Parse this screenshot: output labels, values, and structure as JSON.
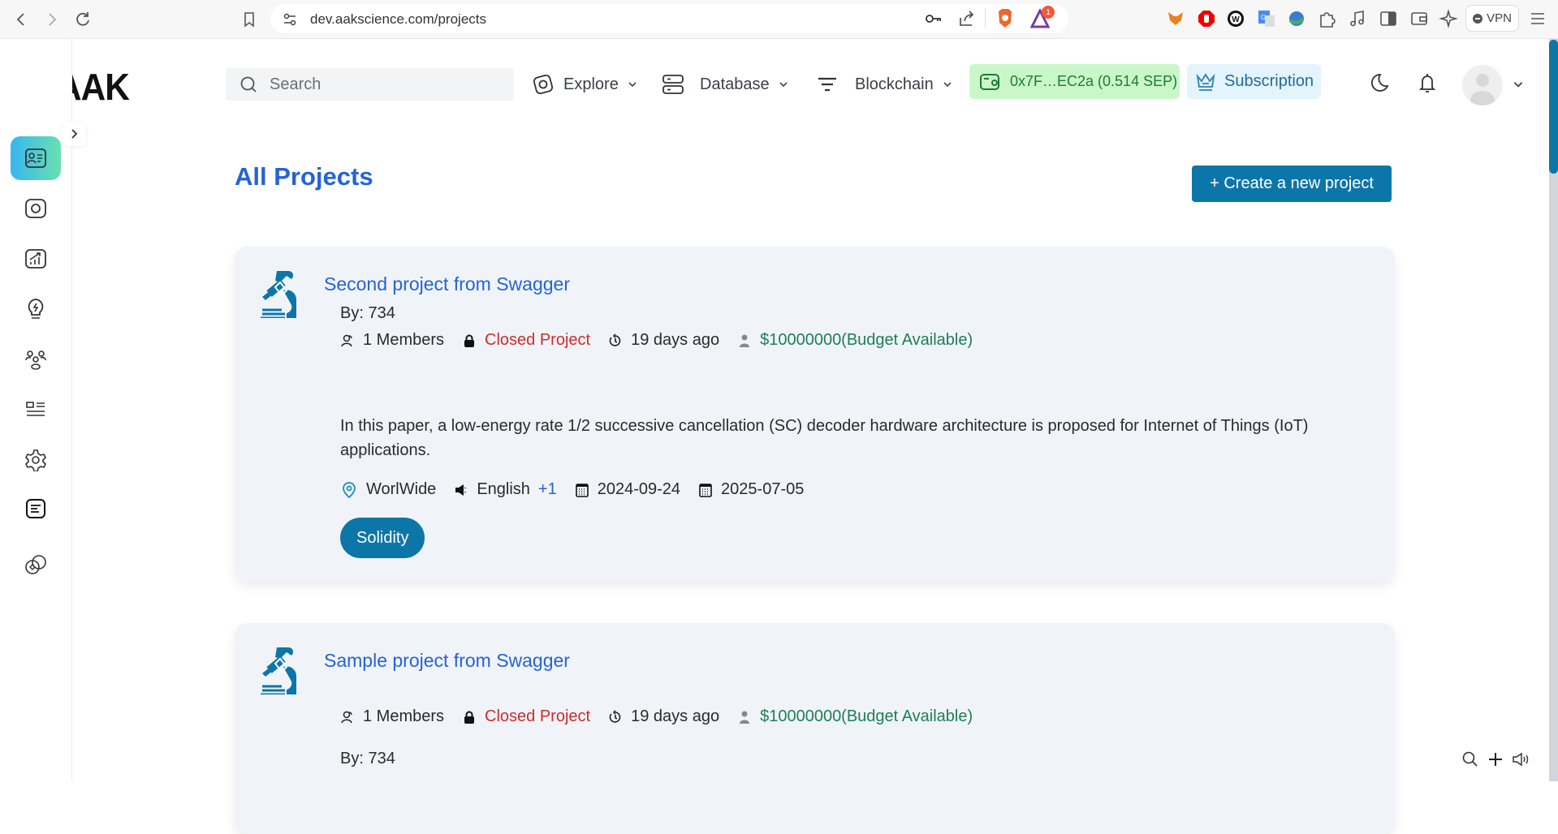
{
  "browser": {
    "url": "dev.aakscience.com/projects",
    "notification_badge": "1",
    "vpn_label": "VPN",
    "extensions": [
      "metamask-icon",
      "adblock-icon",
      "wombat-icon",
      "google-translate-icon",
      "download-manager-icon",
      "puzzle-icon",
      "music-icon",
      "sidebar-icon",
      "wallet-icon",
      "leo-ai-icon"
    ]
  },
  "header": {
    "logo_text": "AAK",
    "search_placeholder": "Search",
    "menus": [
      {
        "label": "Explore",
        "icon": "explore-icon"
      },
      {
        "label": "Database",
        "icon": "database-icon"
      },
      {
        "label": "Blockchain",
        "icon": "blockchain-icon"
      }
    ],
    "wallet": "0x7F…EC2a (0.514 SEP)",
    "subscription": "Subscription",
    "colors": {
      "wallet_bg": "#c9f7c8",
      "subscription_bg": "#e3f4fc",
      "accent": "#0d76a8",
      "title": "#2563d6"
    }
  },
  "sidebar": {
    "items": [
      {
        "icon": "profile-card-icon",
        "active": true
      },
      {
        "icon": "camera-scan-icon",
        "active": false
      },
      {
        "icon": "chart-growth-icon",
        "active": false
      },
      {
        "icon": "idea-bulb-icon",
        "active": false
      },
      {
        "icon": "team-icon",
        "active": false
      },
      {
        "icon": "list-layout-icon",
        "active": false
      },
      {
        "icon": "settings-icon",
        "active": false
      },
      {
        "icon": "document-icon",
        "active": false
      },
      {
        "icon": "coins-icon",
        "active": false
      }
    ]
  },
  "main": {
    "title": "All Projects",
    "create_button": "+ Create a new project",
    "projects": [
      {
        "title": "Second project from Swagger",
        "members": "1 Members",
        "visibility": "Closed Project",
        "created": "19 days ago",
        "budget": "$10000000(Budget Available)",
        "by": "By: 734",
        "description": "In this paper, a low-energy rate 1/2 successive cancellation (SC) decoder hardware architecture is proposed for Internet of Things (IoT) applications.",
        "location": "WorlWide",
        "language": "English",
        "language_extra": "+1",
        "start_date": "2024-09-24",
        "end_date": "2025-07-05",
        "tags": [
          "Solidity"
        ]
      },
      {
        "title": "Sample project from Swagger",
        "members": "1 Members",
        "visibility": "Closed Project",
        "created": "19 days ago",
        "budget": "$10000000(Budget Available)",
        "by": "By: 734"
      }
    ]
  }
}
